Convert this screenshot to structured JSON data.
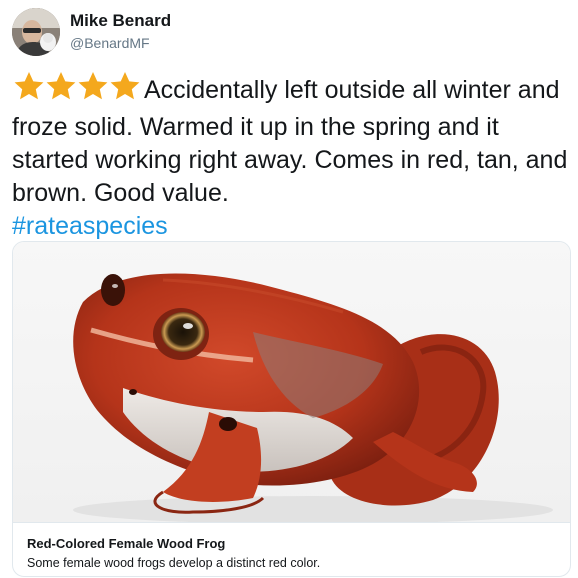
{
  "user": {
    "name": "Mike Benard",
    "handle": "@BenardMF"
  },
  "tweet": {
    "rating": 4,
    "text": "Accidentally left outside all winter and froze solid. Warmed it up in the spring and it started working right away. Comes in red, tan, and brown. Good value.",
    "hashtag": "#rateaspecies"
  },
  "card": {
    "image_icon": "red-wood-frog-photo",
    "title": "Red-Colored Female Wood Frog",
    "description": "Some female wood frogs develop a distinct red color."
  },
  "colors": {
    "star": "#f4a81d",
    "hashtag": "#1b95e0",
    "handle": "#657786",
    "frog": "#b8361c"
  }
}
